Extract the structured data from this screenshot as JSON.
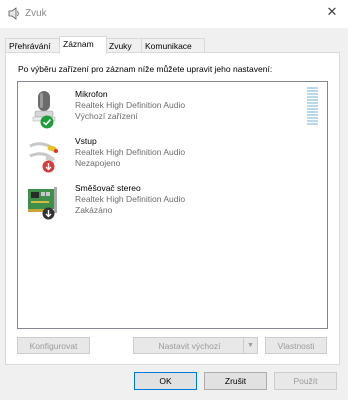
{
  "window": {
    "title": "Zvuk",
    "close_glyph": "✕"
  },
  "tabs": [
    {
      "label": "Přehrávání",
      "active": false
    },
    {
      "label": "Záznam",
      "active": true
    },
    {
      "label": "Zvuky",
      "active": false
    },
    {
      "label": "Komunikace",
      "active": false
    }
  ],
  "instruction": "Po výběru zařízení pro záznam níže můžete upravit jeho nastavení:",
  "devices": [
    {
      "name": "Mikrofon",
      "driver": "Realtek High Definition Audio",
      "status": "Výchozí zařízení",
      "icon": "microphone-icon",
      "badge": "check-badge-icon",
      "badge_color": "#1e9e3a"
    },
    {
      "name": "Vstup",
      "driver": "Realtek High Definition Audio",
      "status": "Nezapojeno",
      "icon": "audio-cable-icon",
      "badge": "unplugged-badge-icon",
      "badge_color": "#d83b3b"
    },
    {
      "name": "Směšovač stereo",
      "driver": "Realtek High Definition Audio",
      "status": "Zakázáno",
      "icon": "sound-card-icon",
      "badge": "disabled-badge-icon",
      "badge_color": "#333333"
    }
  ],
  "buttons": {
    "configure": "Konfigurovat",
    "set_default": "Nastavit výchozí",
    "properties": "Vlastnosti",
    "ok": "OK",
    "cancel": "Zrušit",
    "apply": "Použít"
  }
}
